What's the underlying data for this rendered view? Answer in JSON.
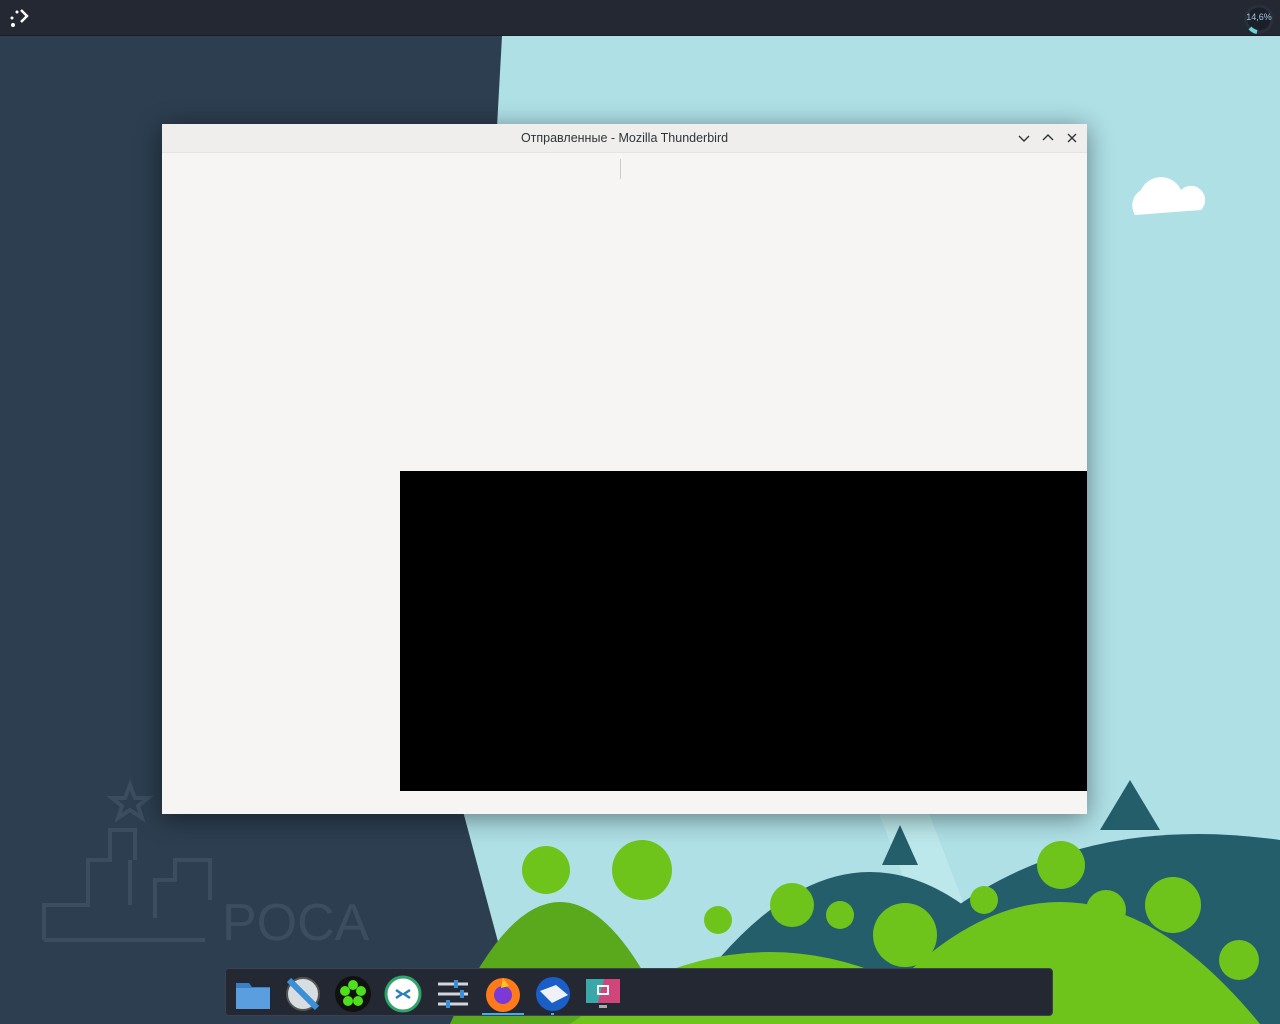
{
  "topbar": {
    "cpu_label": "14,6%",
    "cpu_fraction": 0.146
  },
  "wallpaper": {
    "logo_text": "РОСА"
  },
  "window": {
    "title": "Отправленные - Mozilla Thunderbird"
  },
  "dock": {
    "items": [
      {
        "name": "files",
        "icon": "folder-icon"
      },
      {
        "name": "video-editor",
        "icon": "film-icon"
      },
      {
        "name": "icq",
        "icon": "icq-flower-icon"
      },
      {
        "name": "remote-desktop",
        "icon": "remote-desktop-icon"
      },
      {
        "name": "settings",
        "icon": "sliders-icon"
      },
      {
        "name": "firefox",
        "icon": "firefox-icon",
        "active": true
      },
      {
        "name": "thunderbird",
        "icon": "thunderbird-icon",
        "running": true
      },
      {
        "name": "screenshot",
        "icon": "screenshot-icon"
      }
    ]
  }
}
